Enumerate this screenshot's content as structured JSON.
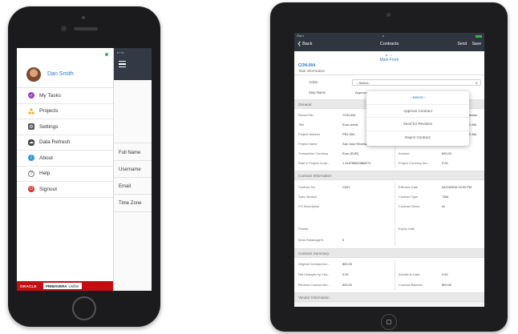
{
  "phone": {
    "user_name": "Dan Smith",
    "menu_items": [
      {
        "label": "My Tasks",
        "icon": "check-circle-icon"
      },
      {
        "label": "Projects",
        "icon": "projects-triangle-icon"
      },
      {
        "label": "Settings",
        "icon": "gear-icon"
      },
      {
        "label": "Data Refresh",
        "icon": "cloud-icon"
      },
      {
        "label": "About",
        "icon": "info-icon"
      },
      {
        "label": "Help",
        "icon": "question-icon"
      },
      {
        "label": "Signout",
        "icon": "power-icon"
      }
    ],
    "side_fields": [
      "Full Name",
      "Username",
      "Email",
      "Time Zone"
    ],
    "brand": {
      "oracle": "ORACLE",
      "primavera": "PRIMAVERA",
      "unifier": "Unifier"
    }
  },
  "ipad": {
    "nav": {
      "back_label": "Back",
      "title": "Contracts",
      "send_label": "Send",
      "save_label": "Save"
    },
    "main_form_label": "Main Form",
    "record_id": "CON-004",
    "record_sub": "Task Information",
    "action_label": "Action",
    "action_value": "--Select--",
    "step_name_label": "Step Name",
    "step_name_value": "Approva",
    "dropdown_options": [
      "--Select--",
      "Approve Contract",
      "Send for Revision",
      "Reject Contract"
    ],
    "sections": {
      "general": "General",
      "contract_information": "Contract Information",
      "contract_summary": "Contract Summary",
      "vendor_information": "Vendor Information"
    },
    "general_left": [
      {
        "label": "Record No.",
        "value": "CON-004"
      },
      {
        "label": "Title",
        "value": "Euro check"
      },
      {
        "label": "Project Number",
        "value": "PRJ-004"
      },
      {
        "label": "Project Name",
        "value": "San Jose Recreation Park E..."
      },
      {
        "label": "Transaction Currency",
        "value": "Euro (EUR)"
      },
      {
        "label": "Rate in Project Curre...",
        "value": "1.316785613884271"
      }
    ],
    "general_right": [
      {
        "label": "",
        "value": "ministrator"
      },
      {
        "label": "",
        "value": "52 AM"
      },
      {
        "label": "",
        "value": "52 AM"
      },
      {
        "label": "Status",
        "value": "Pending"
      },
      {
        "label": "Amount",
        "value": "600.00"
      },
      {
        "label": "Project Currency Am...",
        "value": "0.00"
      }
    ],
    "contract_left": [
      {
        "label": "Contract No",
        "value": "C001"
      },
      {
        "label": "Spec Section",
        "value": ""
      },
      {
        "label": "PO Description",
        "value": ""
      },
      {
        "label": "Priority",
        "value": ""
      },
      {
        "label": "Work Retainage%",
        "value": "0"
      }
    ],
    "contract_right": [
      {
        "label": "Effective Date",
        "value": "02/24/2016 02:00 PM"
      },
      {
        "label": "Contract Type",
        "value": "T&M"
      },
      {
        "label": "Contract Terms",
        "value": "Al"
      },
      {
        "label": "Expiry Date",
        "value": ""
      }
    ],
    "summary_left": [
      {
        "label": "Original Contract Am...",
        "value": "800.00"
      },
      {
        "label": "Net Changes by Cha...",
        "value": "0.00"
      },
      {
        "label": "Revised Contract Am...",
        "value": "800.00"
      }
    ],
    "summary_right": [
      {
        "label": "Actuals to Date",
        "value": "0.00"
      },
      {
        "label": "Contract Balance",
        "value": "800.00"
      }
    ]
  }
}
